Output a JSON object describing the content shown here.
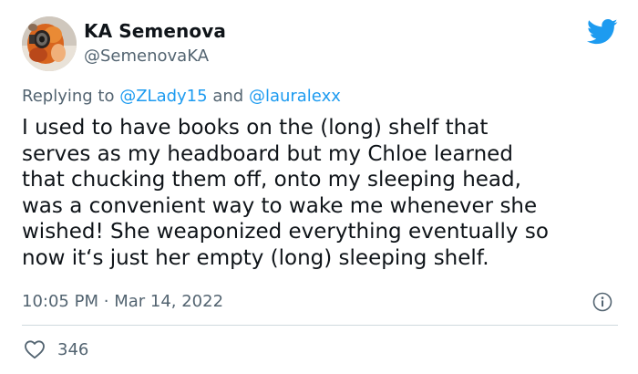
{
  "author": {
    "display_name": "KA Semenova",
    "handle": "@SemenovaKA"
  },
  "reply": {
    "prefix": "Replying to",
    "mention_1": "@ZLady15",
    "conjunction": "and",
    "mention_2": "@lauralexx"
  },
  "tweet": {
    "lines": [
      "I used to have books on the (long) shelf that",
      "serves as my headboard but my Chloe learned",
      "that chucking them off, onto my sleeping head,",
      "was a convenient way to wake me whenever she",
      "wished! She weaponized everything eventually so",
      "now it‘s just her empty (long) sleeping shelf."
    ]
  },
  "meta": {
    "time": "10:05 PM",
    "separator": "·",
    "date": "Mar 14, 2022"
  },
  "engagement": {
    "likes": "346"
  },
  "icons": {
    "brand": "twitter-bird-icon",
    "info": "info-icon",
    "like": "heart-icon"
  },
  "colors": {
    "twitter_blue": "#1d9bf0",
    "text_primary": "#0f1419",
    "text_secondary": "#536471",
    "divider": "#cfd9de"
  }
}
